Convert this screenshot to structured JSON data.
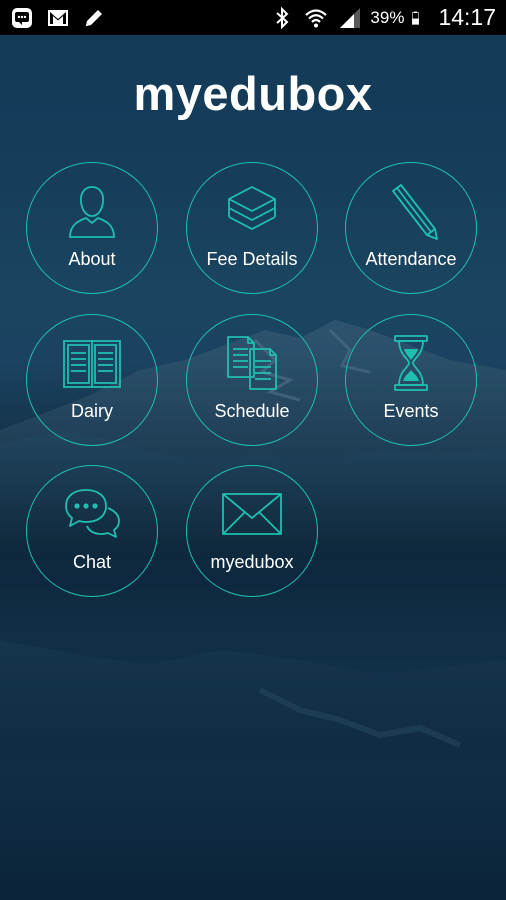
{
  "status_bar": {
    "left_icons": [
      "message-icon",
      "gmail-icon",
      "pencil-icon"
    ],
    "right_icons": [
      "bluetooth-icon",
      "wifi-icon",
      "signal-icon",
      "battery-icon"
    ],
    "battery_percent": "39%",
    "time": "14:17"
  },
  "app": {
    "title": "myedubox"
  },
  "menu": {
    "items": [
      {
        "label": "About",
        "icon": "person-icon"
      },
      {
        "label": "Fee Details",
        "icon": "layers-icon"
      },
      {
        "label": "Attendance",
        "icon": "pencil-icon"
      },
      {
        "label": "Dairy",
        "icon": "book-icon"
      },
      {
        "label": "Schedule",
        "icon": "documents-icon"
      },
      {
        "label": "Events",
        "icon": "hourglass-icon"
      },
      {
        "label": "Chat",
        "icon": "chat-bubbles-icon"
      },
      {
        "label": "myedubox",
        "icon": "envelope-icon"
      }
    ]
  },
  "colors": {
    "accent": "#1fbfb0",
    "background": "#123a57",
    "title": "#ffffff",
    "status_bar": "#000000"
  }
}
